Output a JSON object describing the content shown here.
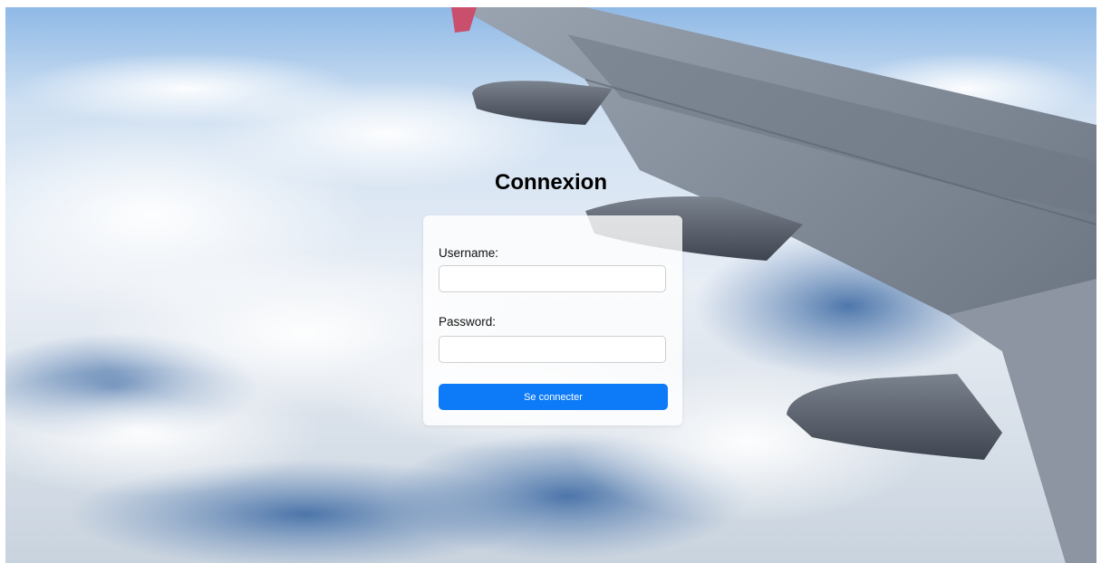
{
  "page": {
    "title": "Connexion"
  },
  "login_form": {
    "username_label": "Username:",
    "username_value": "",
    "password_label": "Password:",
    "password_value": "",
    "submit_label": "Se connecter"
  },
  "colors": {
    "button": "#0d7bf7",
    "card": "#ffffff"
  },
  "background": {
    "description_icon": "airplane-wing-above-clouds-photo"
  }
}
